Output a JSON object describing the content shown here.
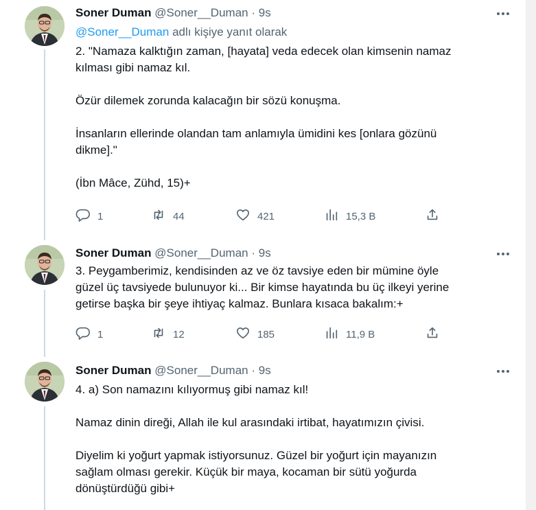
{
  "tweets": [
    {
      "name": "Soner Duman",
      "handle": "@Soner__Duman",
      "separator": "·",
      "time": "9s",
      "replying_mention": "@Soner__Duman",
      "replying_text": " adlı kişiye yanıt olarak",
      "text": "2. \"Namaza kalktığın zaman, [hayata] veda edecek olan kimsenin namaz\nkılması gibi namaz kıl.\n\nÖzür dilemek zorunda kalacağın bir sözü konuşma.\n\nİnsanların ellerinde olandan tam anlamıyla ümidini kes [onlara gözünü\ndikme].\"\n\n(İbn Mâce, Zühd, 15)+",
      "replies": "1",
      "retweets": "44",
      "likes": "421",
      "views": "15,3 B"
    },
    {
      "name": "Soner Duman",
      "handle": "@Soner__Duman",
      "separator": "·",
      "time": "9s",
      "text": "3. Peygamberimiz, kendisinden az ve öz tavsiye eden bir mümine öyle\ngüzel üç tavsiyede bulunuyor ki... Bir kimse hayatında bu üç ilkeyi yerine\ngetirse başka bir şeye ihtiyaç kalmaz. Bunlara kısaca bakalım:+",
      "replies": "1",
      "retweets": "12",
      "likes": "185",
      "views": "11,9 B"
    },
    {
      "name": "Soner Duman",
      "handle": "@Soner__Duman",
      "separator": "·",
      "time": "9s",
      "text": "4. a) Son namazını kılıyormuş gibi namaz kıl!\n\nNamaz dinin direği, Allah ile kul arasındaki irtibat, hayatımızın çivisi.\n\nDiyelim ki yoğurt yapmak istiyorsunuz. Güzel bir yoğurt için mayanızın\nsağlam olması gerekir. Küçük bir maya, kocaman bir sütü yoğurda\ndönüştürdüğü gibi+"
    }
  ],
  "icons": {
    "more": "more-icon",
    "reply": "reply-icon",
    "retweet": "retweet-icon",
    "like": "like-icon",
    "views": "views-icon",
    "share": "share-icon"
  },
  "colors": {
    "text": "#0f1419",
    "secondary": "#536471",
    "accent": "#1d9bf0",
    "thread_line": "#cfd9de"
  }
}
